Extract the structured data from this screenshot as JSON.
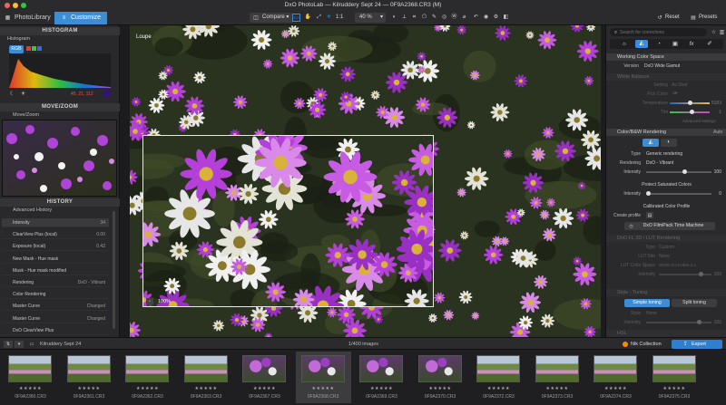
{
  "window": {
    "title": "DxO PhotoLab — Kilruddery Sept 24 — 0F9A2368.CR3 (M)"
  },
  "tabs": [
    {
      "label": "PhotoLibrary"
    },
    {
      "label": "Customize"
    }
  ],
  "toolbar": {
    "compare": "Compare",
    "ratio": "1:1",
    "zoom": "40 %",
    "reset": "Reset",
    "presets": "Presets"
  },
  "left_panel": {
    "histogram": {
      "title": "HISTOGRAM",
      "label": "Histogram",
      "mode": "RGB",
      "readout": "45, 21, 112"
    },
    "move_zoom": {
      "title": "MOVE/ZOOM",
      "label": "Move/Zoom"
    },
    "history": {
      "title": "HISTORY",
      "label": "Advanced History",
      "items": [
        {
          "name": "Intensity",
          "value": "34"
        },
        {
          "name": "ClearView Plus (local)",
          "value": "0.00"
        },
        {
          "name": "Exposure (local)",
          "value": "0.42"
        },
        {
          "name": "New Mask - Hue mask",
          "value": ""
        },
        {
          "name": "Mask - Hue mask modified",
          "value": ""
        },
        {
          "name": "Rendering",
          "value": "DxO - Vibrant"
        },
        {
          "name": "Color Rendering",
          "value": ""
        },
        {
          "name": "Master Curve",
          "value": "Changed"
        },
        {
          "name": "Master Curve",
          "value": "Changed"
        },
        {
          "name": "DxO ClearView Plus",
          "value": ""
        }
      ]
    }
  },
  "viewer": {
    "loupe_label": "Loupe",
    "loupe_zoom": "100%"
  },
  "right_panel": {
    "search_placeholder": "Search for corrections",
    "working_color_space": {
      "title": "Working Color Space",
      "version_label": "Version",
      "version_value": "DxO Wide Gamut"
    },
    "white_balance": {
      "title": "White Balance",
      "setting_label": "Setting",
      "setting_value": "As Shot",
      "picker_label": "Pick Color",
      "temp_label": "Temperature",
      "temp_value": "5183",
      "tint_label": "Tint",
      "tint_value": "1",
      "advanced": "Advanced settings"
    },
    "color_rendering": {
      "title": "Color/B&W Rendering",
      "auto": "Auto",
      "type_label": "Type",
      "type_value": "Generic rendering",
      "rendering_label": "Rendering",
      "rendering_value": "DxO - Vibrant",
      "intensity_label": "Intensity",
      "intensity_value": "100",
      "protect_title": "Protect Saturated Colors",
      "protect_intensity_label": "Intensity",
      "protect_intensity_value": "0",
      "calibrated_title": "Calibrated Color Profile",
      "create_profile_label": "Create profile",
      "filmpack": "DxO FilmPack Time Machine"
    },
    "lut": {
      "title": "DxO FL 3D / LUT Rendering",
      "type_label": "Type",
      "type_value": "Custom",
      "file_label": "LUT File",
      "file_value": "None",
      "colorspace_label": "LUT Color Space",
      "colorspace_value": "sRGB IEC61966-2.1",
      "intensity_label": "Intensity",
      "intensity_value": "100"
    },
    "style_toning": {
      "title": "Style - Toning",
      "simple": "Simple toning",
      "split": "Split toning",
      "style_label": "Style",
      "style_value": "None",
      "intensity_label": "Intensity",
      "intensity_value": "100",
      "hsl": "HSL"
    }
  },
  "filmstrip_bar": {
    "project": "Kilruddery Sept 24",
    "count": "1/400 images",
    "nik": "Nik Collection",
    "export": "Export"
  },
  "filmstrip": [
    {
      "file": "0F9A2360.CR3",
      "stars": "★★★★★",
      "tone": "garden"
    },
    {
      "file": "0F9A2361.CR3",
      "stars": "★★★★★",
      "tone": "garden"
    },
    {
      "file": "0F9A2362.CR3",
      "stars": "★★★★★",
      "tone": "garden"
    },
    {
      "file": "0F9A2363.CR3",
      "stars": "★★★★★",
      "tone": "garden"
    },
    {
      "file": "0F9A2367.CR3",
      "stars": "★★★★★",
      "tone": "flowers"
    },
    {
      "file": "0F9A2368.CR3",
      "stars": "★★★★★",
      "tone": "flowers"
    },
    {
      "file": "0F9A2369.CR3",
      "stars": "★★★★★",
      "tone": "flowers"
    },
    {
      "file": "0F9A2370.CR3",
      "stars": "★★★★★",
      "tone": "flowers"
    },
    {
      "file": "0F9A2372.CR3",
      "stars": "★★★★★",
      "tone": "garden"
    },
    {
      "file": "0F9A2373.CR3",
      "stars": "★★★★★",
      "tone": "garden"
    },
    {
      "file": "0F9A2374.CR3",
      "stars": "★★★★★",
      "tone": "garden"
    },
    {
      "file": "0F9A2375.CR3",
      "stars": "★★★★★",
      "tone": "garden"
    }
  ],
  "colors": {
    "accent": "#3a8dd6",
    "export": "#2f7fd0",
    "panel": "#29292b",
    "header": "#353538"
  }
}
